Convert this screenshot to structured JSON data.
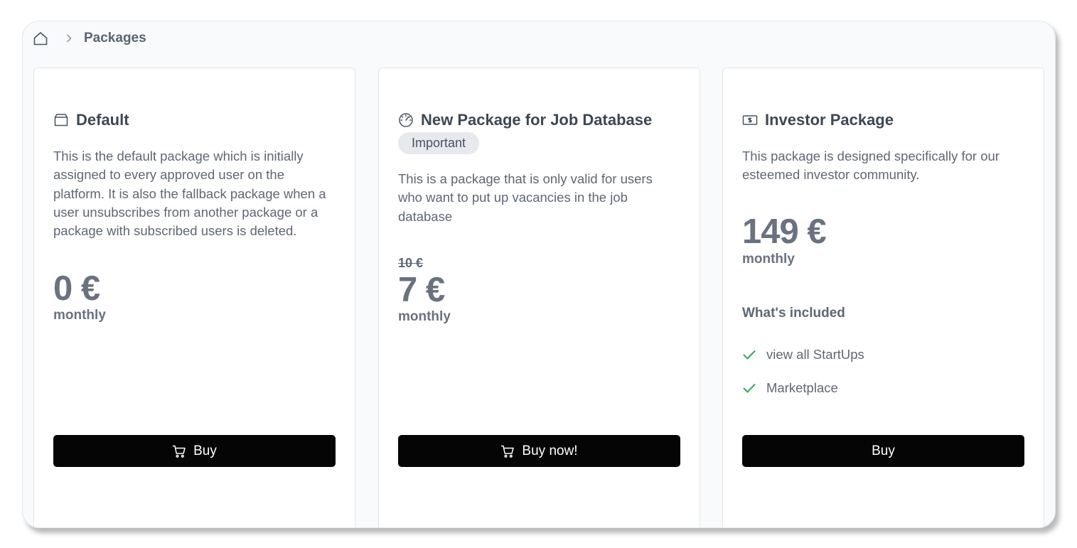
{
  "breadcrumb": {
    "home_icon": "home-icon",
    "separator_icon": "chevron-right-icon",
    "current": "Packages"
  },
  "packages": [
    {
      "icon": "archive-box-icon",
      "title": "Default",
      "badge": "",
      "description": "This is the default package which is initially assigned to every approved user on the platform. It is also the fallback package when a user unsubscribes from another package or a package with subscribed users is deleted.",
      "old_price": "",
      "price": "0 €",
      "period": "monthly",
      "included_title": "",
      "features": [],
      "button_label": "Buy",
      "button_icon": "cart-icon"
    },
    {
      "icon": "gauge-icon",
      "title": "New Package for Job Database",
      "badge": "Important",
      "description": "This is a package that is only valid for users who want to put up vacancies in the job database",
      "old_price": "10 €",
      "price": "7 €",
      "period": "monthly",
      "included_title": "",
      "features": [],
      "button_label": "Buy now!",
      "button_icon": "cart-icon"
    },
    {
      "icon": "banknote-icon",
      "title": "Investor Package",
      "badge": "",
      "description": "This package is designed specifically for our esteemed investor community.",
      "old_price": "",
      "price": "149 €",
      "period": "monthly",
      "included_title": "What's included",
      "features": [
        "view all StartUps",
        "Marketplace"
      ],
      "button_label": "Buy",
      "button_icon": ""
    }
  ],
  "colors": {
    "button_bg": "#050505",
    "check_green": "#3aa55d",
    "badge_bg": "#e6e9ed",
    "price_text": "#6a7280"
  }
}
